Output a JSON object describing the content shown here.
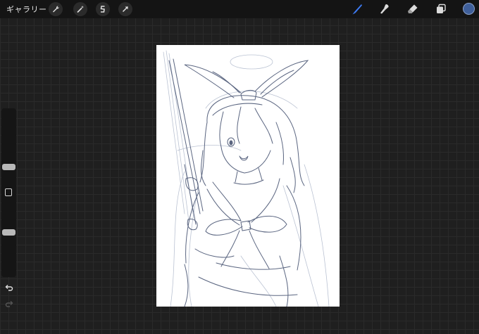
{
  "topbar": {
    "gallery_label": "ギャラリー",
    "left_tools": [
      "wrench-icon",
      "magic-wand-icon",
      "selection-icon",
      "transform-arrow-icon"
    ],
    "right_tools": [
      "brush-icon",
      "smudge-icon",
      "eraser-icon",
      "layers-icon"
    ],
    "active_tool": "brush-icon",
    "active_tool_color": "#3d7bf5",
    "current_color": "#3f5f9a"
  },
  "sidebar": {
    "brush_size_level": 0.35,
    "brush_opacity_level": 0.62,
    "icons": [
      "modify-square-icon",
      "undo-icon",
      "redo-icon"
    ],
    "redo_enabled": false
  },
  "canvas": {
    "background": "#ffffff",
    "sketch_color": "#5a6580",
    "sketch_light_color": "#aab4c8"
  }
}
